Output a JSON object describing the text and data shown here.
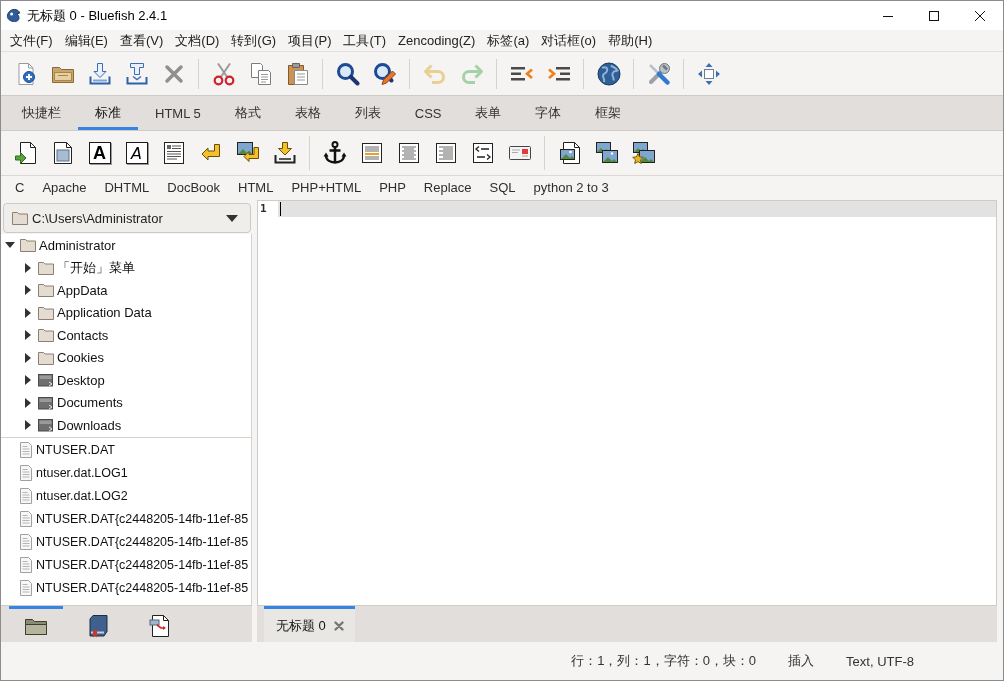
{
  "window": {
    "title": "无标题 0 - Bluefish 2.4.1"
  },
  "menu_bar": [
    "文件(F)",
    "编辑(E)",
    "查看(V)",
    "文档(D)",
    "转到(G)",
    "项目(P)",
    "工具(T)",
    "Zencoding(Z)",
    "标签(a)",
    "对话框(o)",
    "帮助(H)"
  ],
  "main_toolbar": [
    {
      "kind": "new",
      "disabled": false
    },
    {
      "kind": "open",
      "disabled": false
    },
    {
      "kind": "save",
      "disabled": false
    },
    {
      "kind": "save-as",
      "disabled": false
    },
    {
      "kind": "close",
      "disabled": false
    },
    {
      "kind": "separator"
    },
    {
      "kind": "cut",
      "disabled": false
    },
    {
      "kind": "copy",
      "disabled": false
    },
    {
      "kind": "paste",
      "disabled": false
    },
    {
      "kind": "separator"
    },
    {
      "kind": "find",
      "disabled": false
    },
    {
      "kind": "replace",
      "disabled": false
    },
    {
      "kind": "separator"
    },
    {
      "kind": "undo",
      "disabled": true
    },
    {
      "kind": "redo",
      "disabled": true
    },
    {
      "kind": "separator"
    },
    {
      "kind": "unindent",
      "disabled": false
    },
    {
      "kind": "indent",
      "disabled": false
    },
    {
      "kind": "separator"
    },
    {
      "kind": "preview",
      "disabled": false
    },
    {
      "kind": "separator"
    },
    {
      "kind": "tools",
      "disabled": false
    },
    {
      "kind": "separator"
    },
    {
      "kind": "fullscreen",
      "disabled": false
    }
  ],
  "html_tabs": [
    {
      "label": "快捷栏",
      "selected": false
    },
    {
      "label": "标准",
      "selected": true
    },
    {
      "label": "HTML 5",
      "selected": false
    },
    {
      "label": "格式",
      "selected": false
    },
    {
      "label": "表格",
      "selected": false
    },
    {
      "label": "列表",
      "selected": false
    },
    {
      "label": "CSS",
      "selected": false
    },
    {
      "label": "表单",
      "selected": false
    },
    {
      "label": "字体",
      "selected": false
    },
    {
      "label": "框架",
      "selected": false
    }
  ],
  "tag_toolbar": [
    {
      "kind": "quickstart"
    },
    {
      "kind": "body"
    },
    {
      "kind": "bold",
      "glyph": "A"
    },
    {
      "kind": "italic",
      "glyph": "A"
    },
    {
      "kind": "paragraph"
    },
    {
      "kind": "break"
    },
    {
      "kind": "break-clear"
    },
    {
      "kind": "nbsp"
    },
    {
      "kind": "separator"
    },
    {
      "kind": "anchor"
    },
    {
      "kind": "rule"
    },
    {
      "kind": "center"
    },
    {
      "kind": "right"
    },
    {
      "kind": "comment"
    },
    {
      "kind": "email"
    },
    {
      "kind": "separator"
    },
    {
      "kind": "image"
    },
    {
      "kind": "thumbnail"
    },
    {
      "kind": "multi-thumbnail"
    }
  ],
  "snippet_menus": [
    "C",
    "Apache",
    "DHTML",
    "DocBook",
    "HTML",
    "PHP+HTML",
    "PHP",
    "Replace",
    "SQL",
    "python 2 to 3"
  ],
  "file_browser": {
    "path": "C:\\Users\\Administrator",
    "tree": [
      {
        "name": "Administrator",
        "kind": "folder",
        "expanded": true,
        "children": [
          {
            "name": "「开始」菜单",
            "kind": "folder",
            "expanded": false
          },
          {
            "name": "AppData",
            "kind": "folder",
            "expanded": false
          },
          {
            "name": "Application Data",
            "kind": "folder",
            "expanded": false
          },
          {
            "name": "Contacts",
            "kind": "folder",
            "expanded": false
          },
          {
            "name": "Cookies",
            "kind": "folder",
            "expanded": false
          },
          {
            "name": "Desktop",
            "kind": "link",
            "expanded": false
          },
          {
            "name": "Documents",
            "kind": "link",
            "expanded": false
          },
          {
            "name": "Downloads",
            "kind": "link",
            "expanded": false
          }
        ]
      }
    ],
    "files": [
      "NTUSER.DAT",
      "ntuser.dat.LOG1",
      "ntuser.dat.LOG2",
      "NTUSER.DAT{c2448205-14fb-11ef-85",
      "NTUSER.DAT{c2448205-14fb-11ef-85",
      "NTUSER.DAT{c2448205-14fb-11ef-85",
      "NTUSER.DAT{c2448205-14fb-11ef-85"
    ]
  },
  "sidebar_tabs": [
    {
      "kind": "files",
      "selected": true
    },
    {
      "kind": "bookmarks",
      "selected": false
    },
    {
      "kind": "snippets",
      "selected": false
    }
  ],
  "editor": {
    "lines": [
      {
        "number": "1",
        "current": true
      }
    ]
  },
  "document_tabs": [
    {
      "title": "无标题 0",
      "selected": true
    }
  ],
  "status_bar": {
    "position": "行：1，列：1，字符：0，块：0",
    "mode": "插入",
    "encoding": "Text, UTF-8"
  }
}
